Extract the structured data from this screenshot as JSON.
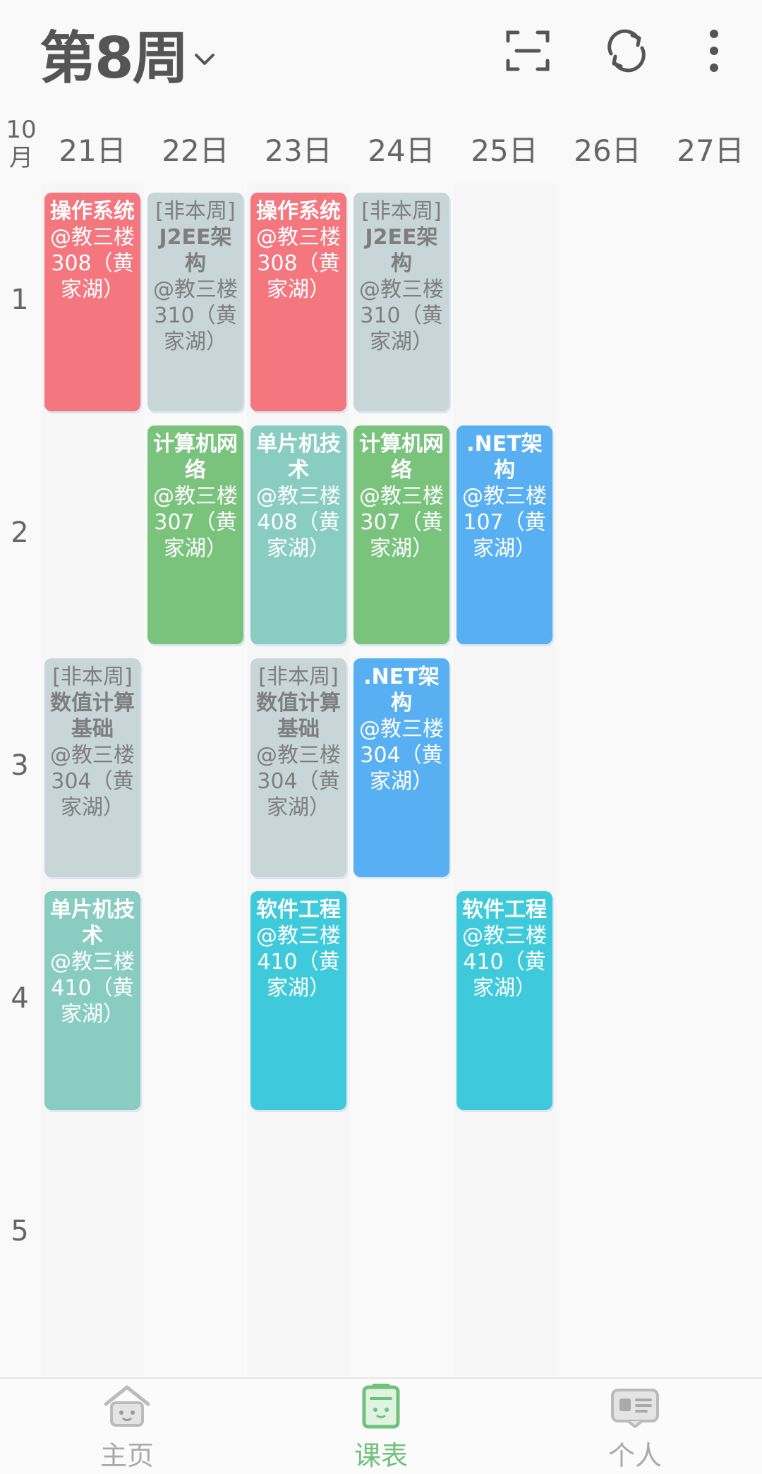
{
  "header": {
    "week_title": "第8周",
    "icons": [
      "scan-icon",
      "refresh-icon",
      "more-vert-icon"
    ]
  },
  "dates": {
    "month": "10月",
    "days": [
      "21日",
      "22日",
      "23日",
      "24日",
      "25日",
      "26日",
      "27日"
    ]
  },
  "periods": [
    "1",
    "2",
    "3",
    "4",
    "5"
  ],
  "courses": [
    {
      "day": 0,
      "period": 0,
      "tag": "",
      "name": "操作系统",
      "room": "@教三楼308（黄家湖）",
      "color": "#f4767e"
    },
    {
      "day": 1,
      "period": 0,
      "tag": "[非本周]",
      "name": "J2EE架构",
      "room": "@教三楼310（黄家湖）",
      "color": "#c8d6d8"
    },
    {
      "day": 2,
      "period": 0,
      "tag": "",
      "name": "操作系统",
      "room": "@教三楼308（黄家湖）",
      "color": "#f4767e"
    },
    {
      "day": 3,
      "period": 0,
      "tag": "[非本周]",
      "name": "J2EE架构",
      "room": "@教三楼310（黄家湖）",
      "color": "#c8d6d8"
    },
    {
      "day": 1,
      "period": 1,
      "tag": "",
      "name": "计算机网络",
      "room": "@教三楼307（黄家湖）",
      "color": "#7ac37d"
    },
    {
      "day": 2,
      "period": 1,
      "tag": "",
      "name": "单片机技术",
      "room": "@教三楼408（黄家湖）",
      "color": "#88ccc2"
    },
    {
      "day": 3,
      "period": 1,
      "tag": "",
      "name": "计算机网络",
      "room": "@教三楼307（黄家湖）",
      "color": "#7ac37d"
    },
    {
      "day": 4,
      "period": 1,
      "tag": "",
      "name": ".NET架构",
      "room": "@教三楼107（黄家湖）",
      "color": "#58b0f2"
    },
    {
      "day": 0,
      "period": 2,
      "tag": "[非本周]",
      "name": "数值计算基础",
      "room": "@教三楼304（黄家湖）",
      "color": "#c8d6d8"
    },
    {
      "day": 2,
      "period": 2,
      "tag": "[非本周]",
      "name": "数值计算基础",
      "room": "@教三楼304（黄家湖）",
      "color": "#c8d6d8"
    },
    {
      "day": 3,
      "period": 2,
      "tag": "",
      "name": ".NET架构",
      "room": "@教三楼304（黄家湖）",
      "color": "#58b0f2"
    },
    {
      "day": 0,
      "period": 3,
      "tag": "",
      "name": "单片机技术",
      "room": "@教三楼410（黄家湖）",
      "color": "#88ccc2"
    },
    {
      "day": 2,
      "period": 3,
      "tag": "",
      "name": "软件工程",
      "room": "@教三楼410（黄家湖）",
      "color": "#3fcadb"
    },
    {
      "day": 4,
      "period": 3,
      "tag": "",
      "name": "软件工程",
      "room": "@教三楼410（黄家湖）",
      "color": "#3fcadb"
    }
  ],
  "bottom_nav": {
    "items": [
      {
        "label": "主页",
        "icon": "home-icon",
        "active": false
      },
      {
        "label": "课表",
        "icon": "schedule-icon",
        "active": true
      },
      {
        "label": "个人",
        "icon": "profile-card-icon",
        "active": false
      }
    ],
    "active_color": "#6fc27a",
    "inactive_color": "#aaaaaa"
  }
}
